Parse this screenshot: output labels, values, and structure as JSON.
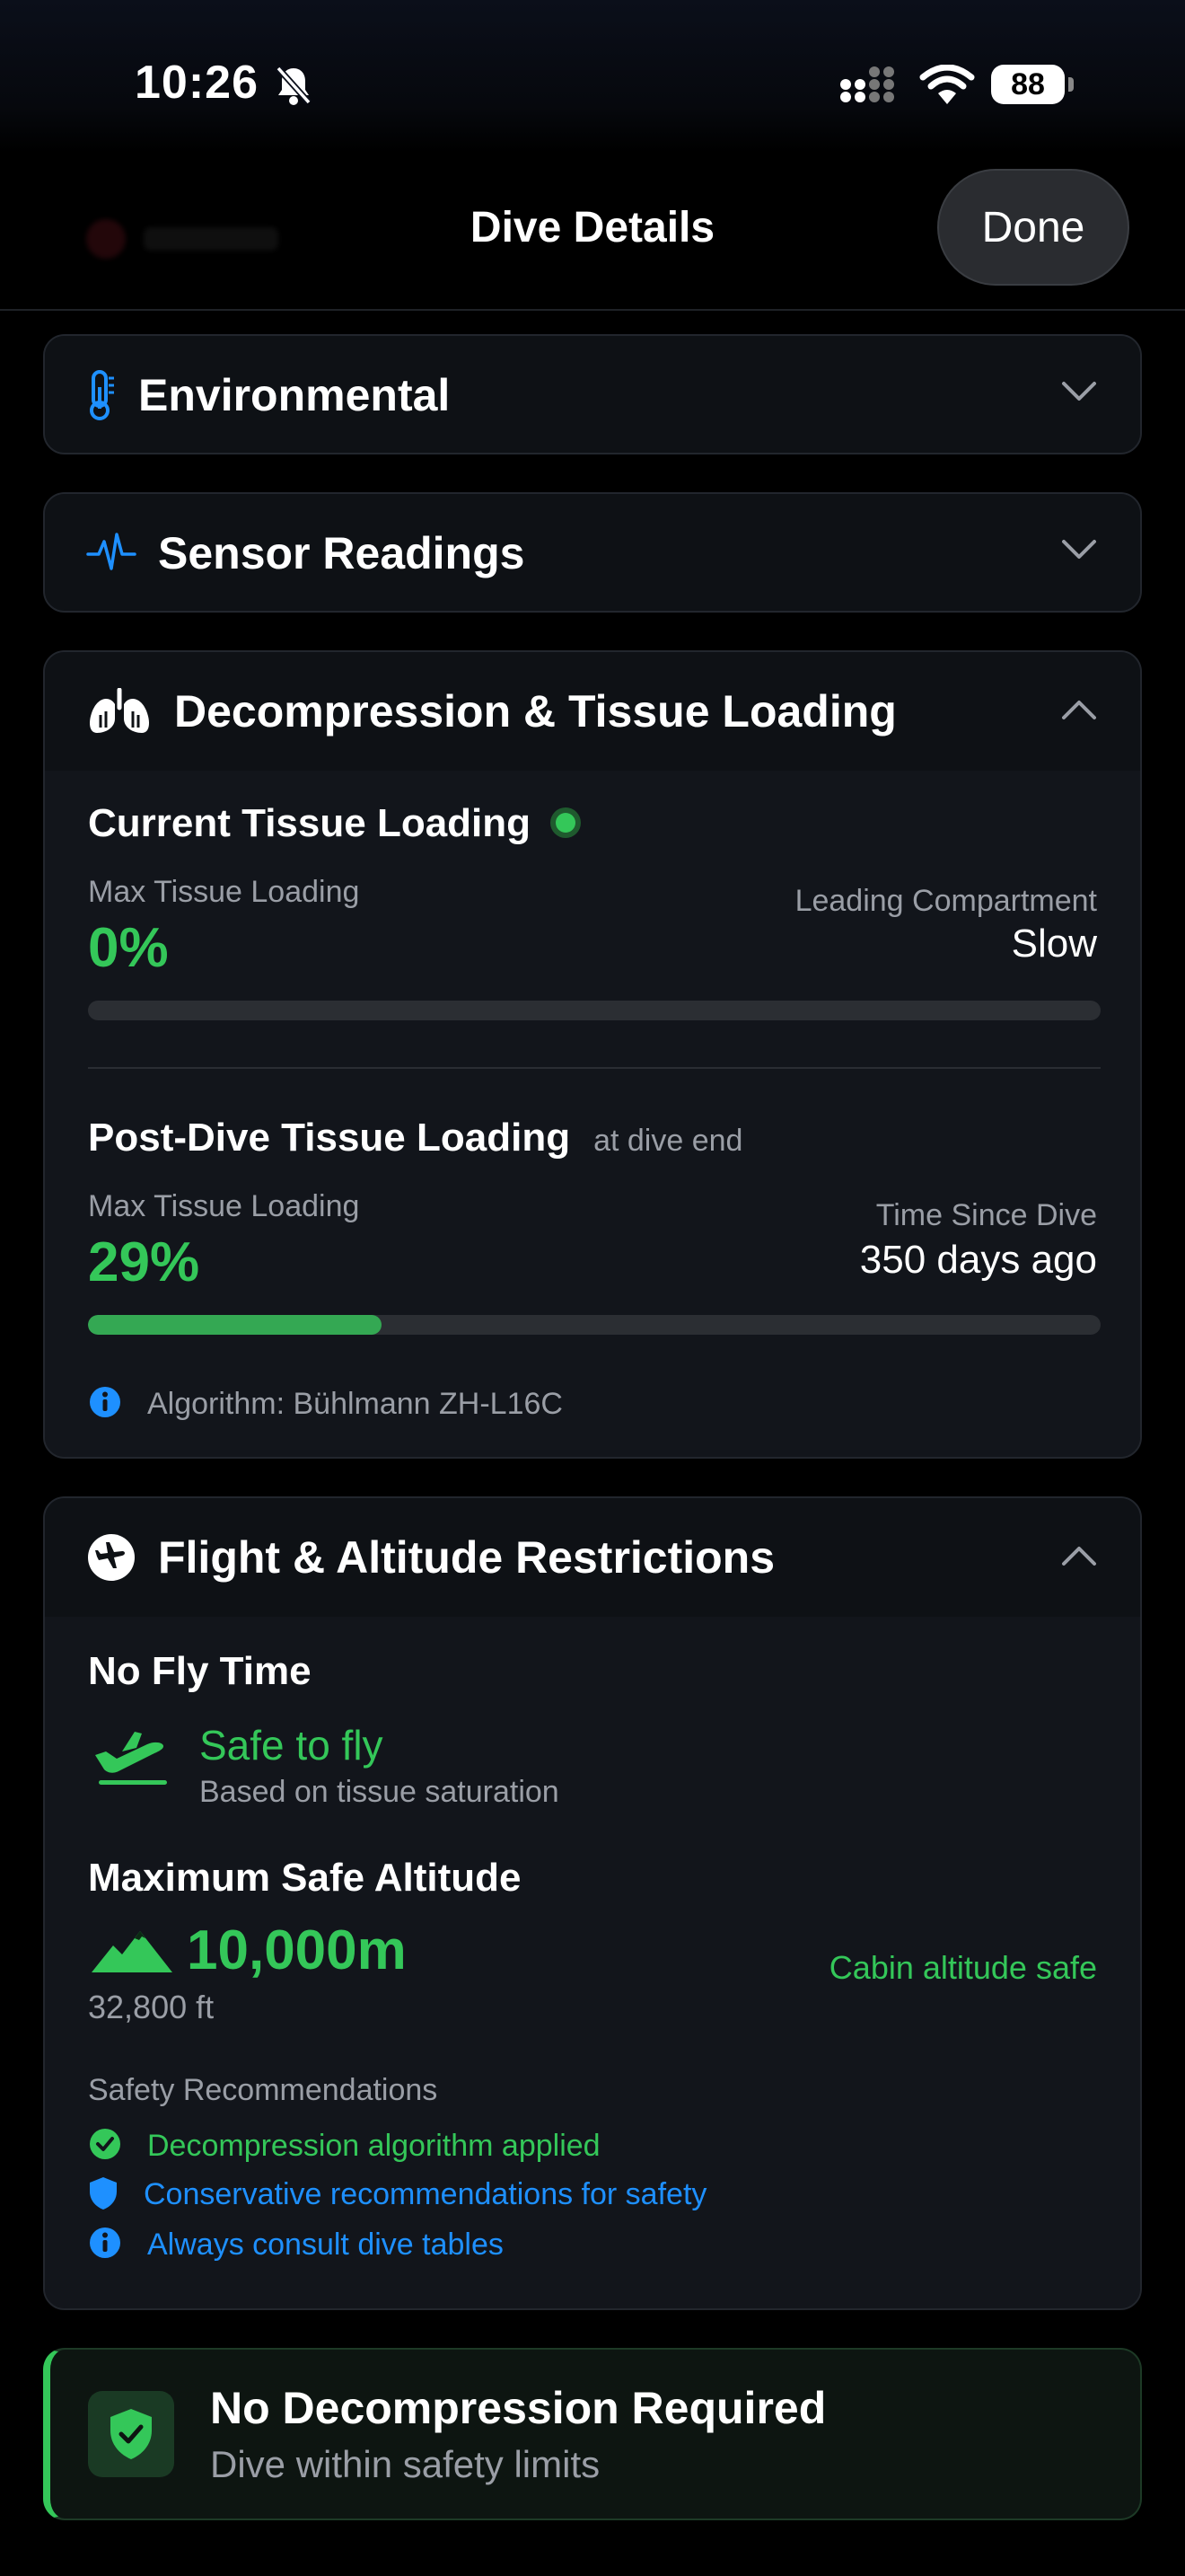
{
  "status_bar": {
    "time": "10:26",
    "battery": "88"
  },
  "nav": {
    "title": "Dive Details",
    "done_label": "Done"
  },
  "sections": {
    "environmental": {
      "title": "Environmental"
    },
    "sensor": {
      "title": "Sensor Readings"
    },
    "deco": {
      "title": "Decompression & Tissue Loading",
      "current": {
        "title": "Current Tissue Loading",
        "max_label": "Max Tissue Loading",
        "max_value": "0%",
        "leading_label": "Leading Compartment",
        "leading_value": "Slow",
        "progress": 0
      },
      "post": {
        "title": "Post-Dive Tissue Loading",
        "subtitle": "at dive end",
        "max_label": "Max Tissue Loading",
        "max_value": "29%",
        "time_label": "Time Since Dive",
        "time_value": "350 days ago",
        "progress": 0.29
      },
      "algorithm": "Algorithm: Bühlmann ZH-L16C"
    },
    "flight": {
      "title": "Flight & Altitude Restrictions",
      "no_fly_title": "No Fly Time",
      "safe_status": "Safe to fly",
      "safe_sub": "Based on tissue saturation",
      "altitude_title": "Maximum Safe Altitude",
      "altitude_value": "10,000m",
      "altitude_ft": "32,800 ft",
      "cabin_status": "Cabin altitude safe",
      "recommendations_title": "Safety Recommendations",
      "recommendations": [
        "Decompression algorithm applied",
        "Conservative recommendations for safety",
        "Always consult dive tables"
      ]
    }
  },
  "banner": {
    "title": "No Decompression Required",
    "subtitle": "Dive within safety limits"
  },
  "colors": {
    "accent_green": "#34c759",
    "accent_blue": "#1e90ff",
    "background": "#000000"
  }
}
